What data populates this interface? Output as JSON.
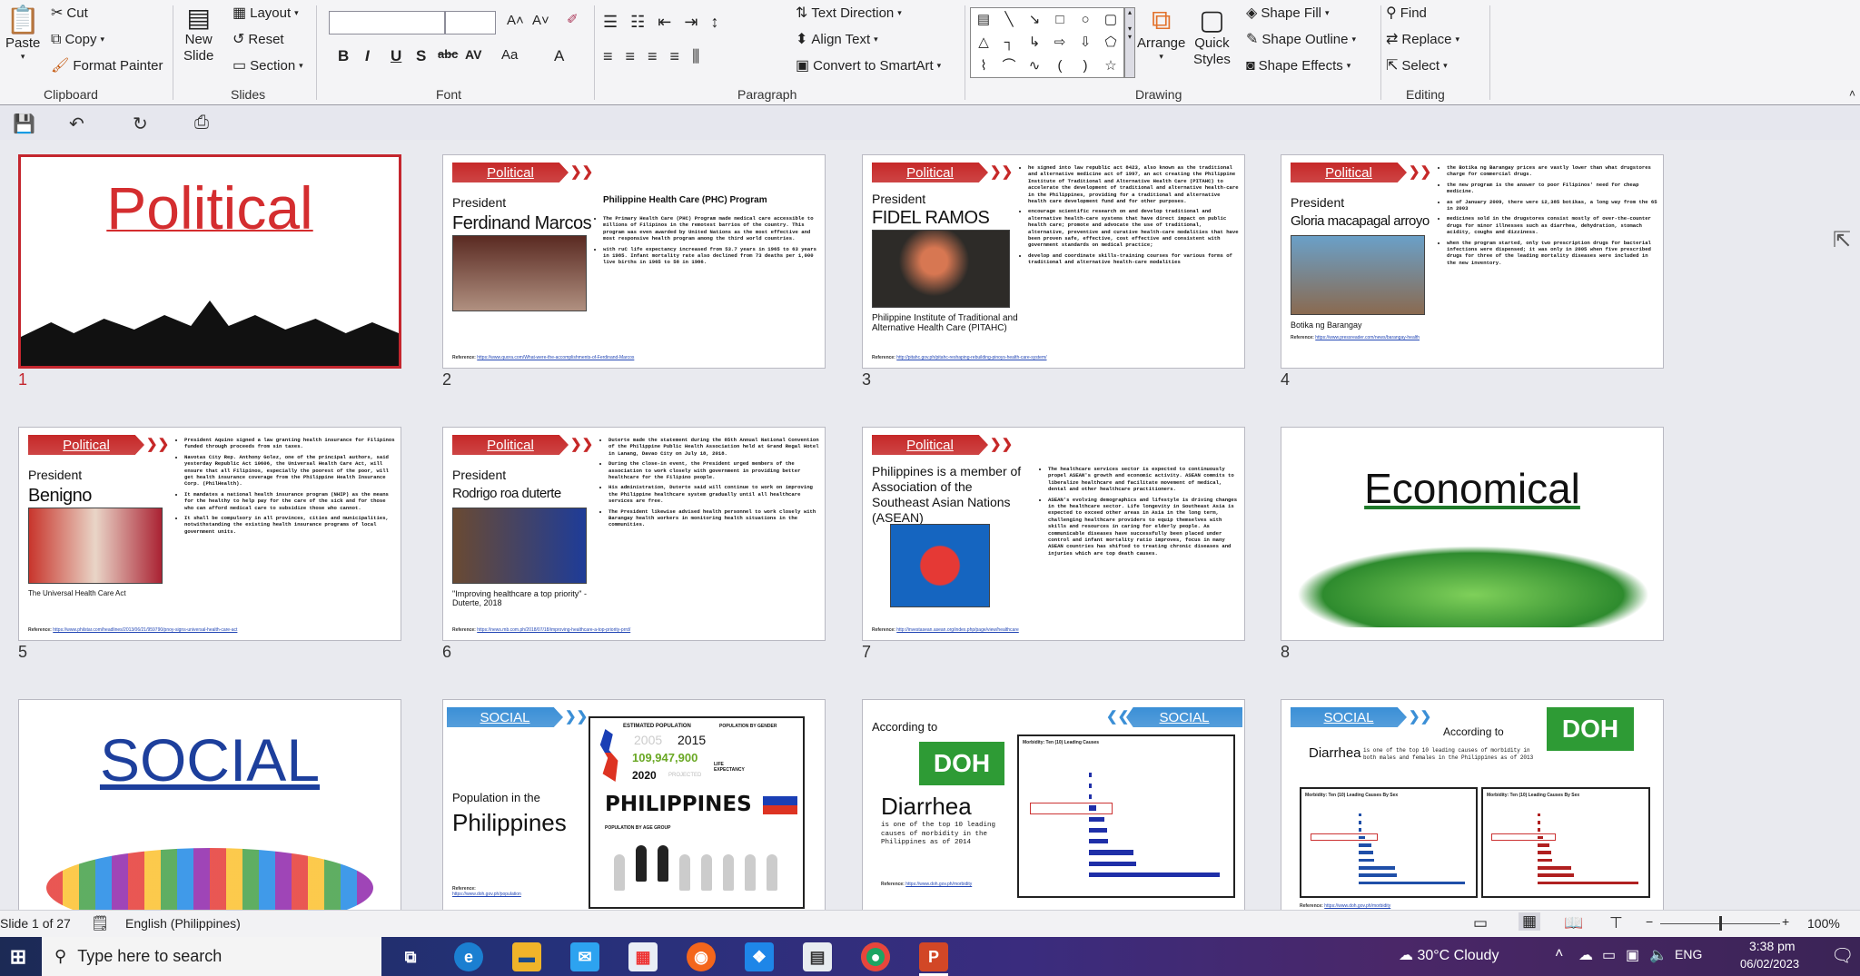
{
  "ribbon": {
    "clipboard": {
      "label": "Clipboard",
      "paste": "Paste",
      "cut": "Cut",
      "copy": "Copy",
      "format_painter": "Format Painter"
    },
    "slides": {
      "label": "Slides",
      "new_slide_1": "New",
      "new_slide_2": "Slide",
      "layout": "Layout",
      "reset": "Reset",
      "section": "Section"
    },
    "font": {
      "label": "Font",
      "font_name": "",
      "font_size": "",
      "grow": "A˄",
      "shrink": "A˅",
      "bold": "B",
      "italic": "I",
      "underline": "U",
      "shadow": "S",
      "strike": "abc",
      "spacing": "AV",
      "case": "Aa",
      "color": "A"
    },
    "paragraph": {
      "label": "Paragraph",
      "text_direction": "Text Direction",
      "align_text": "Align Text",
      "smartart": "Convert to SmartArt"
    },
    "drawing": {
      "label": "Drawing",
      "shapes": [
        "▤",
        "╲",
        "↘",
        "□",
        "○",
        "▢",
        "△",
        "┐",
        "↳",
        "⇨",
        "⇩",
        "⬠",
        "⌇",
        "⌒",
        "∿",
        "(",
        ")",
        "☆"
      ],
      "arrange": "Arrange",
      "quick_styles_1": "Quick",
      "quick_styles_2": "Styles",
      "shape_fill": "Shape Fill",
      "shape_outline": "Shape Outline",
      "shape_effects": "Shape Effects"
    },
    "editing": {
      "label": "Editing",
      "find": "Find",
      "replace": "Replace",
      "select": "Select"
    }
  },
  "qat": {
    "save": "💾",
    "undo": "↶",
    "redo": "↻",
    "present": "⎙"
  },
  "slides": [
    {
      "num": "1",
      "kind": "title",
      "title": "Political",
      "color": "#d42d2f"
    },
    {
      "num": "2",
      "kind": "political",
      "banner": "Political",
      "pre": "President",
      "name": "Ferdinand Marcos",
      "subhead": "Philippine Health Care (PHC) Program",
      "bullets": [
        "The Primary Health Care (PHC) Program made medical care accessible to millions of Filipinos in the remotest barrios of the country. This program was even awarded by United Nations as the most effective and most responsive health program among the third world countries.",
        "with ruC life expectancy increased from 53.7 years in 1965 to 63 years in 1985. Infant mortality rate also declined from 73 deaths per 1,000 live births in 1965 to 58 in 1986."
      ],
      "ref_label": "Reference:",
      "ref": "https://www.quora.com/What-were-the-accomplishments-of-Ferdinand-Marcos"
    },
    {
      "num": "3",
      "kind": "political",
      "banner": "Political",
      "pre": "President",
      "name": "FIDEL RAMOS",
      "caption": "Philippine Institute of Traditional and Alternative Health Care (PITAHC)",
      "bullets": [
        "he signed into law republic act 8423, also known as the traditional and alternative medicine act of 1997, an act creating the Philippine Institute of Traditional and Alternative Health Care (PITAHC) to accelerate the development of traditional and alternative health-care in the Philippines, providing for a traditional and alternative health care development fund and for other purposes.",
        "encourage scientific research on and develop traditional and alternative health-care systems that have direct impact on public health care; promote and advocate the use of traditional, alternative, preventive and curative health-care modalities that have been proven safe, effective, cost effective and consistent with government standards on medical practice;",
        "develop and coordinate skills-training courses for various forms of traditional and alternative health-care modalities"
      ],
      "ref_label": "Reference:",
      "ref": "http://pitahc.gov.ph/pitahc-reshaping-rebuilding-pinoys-health-care-system/"
    },
    {
      "num": "4",
      "kind": "political",
      "banner": "Political",
      "pre": "President",
      "name": "Gloria macapagal arroyo",
      "caption": "Botika ng Barangay",
      "bullets": [
        "the Botika ng Barangay prices are vastly lower than what drugstores charge for commercial drugs.",
        "the new program is the answer to poor Filipinos' need for cheap medicine.",
        "as of January 2009, there were 12,385 botikas, a long way from the 65 in 2003",
        "medicines sold in the drugstores consist mostly of over-the-counter drugs for minor illnesses such as diarrhea, dehydration, stomach acidity, coughs and dizziness.",
        "when the program started, only two prescription drugs for bacterial infections were dispensed; it was only in 2005 when five prescribed drugs for three of the leading mortality diseases were included in the new inventory."
      ],
      "ref_label": "Reference:",
      "ref": "https://www.pressreader.com/news/barangay-health"
    },
    {
      "num": "5",
      "kind": "political",
      "banner": "Political",
      "pre": "President",
      "name": "Benigno",
      "caption": "The Universal Health Care Act",
      "bullets": [
        "President Aquino signed a law granting health insurance for Filipinos funded through proceeds from sin taxes.",
        "Navotas City Rep. Anthony Golez, one of the principal authors, said yesterday Republic Act 10606, the Universal Health Care Act, will ensure that all Filipinos, especially the poorest of the poor, will get health insurance coverage from the Philippine Health Insurance Corp. (PhilHealth).",
        "It mandates a national health insurance program (NHIP) as the means for the healthy to help pay for the care of the sick and for those who can afford medical care to subsidize those who cannot.",
        "It shall be compulsory in all provinces, cities and municipalities, notwithstanding the existing health insurance programs of local government units."
      ],
      "ref_label": "Reference:",
      "ref": "https://www.philstar.com/headlines/2013/06/21/959790/pnoy-signs-universal-health-care-act"
    },
    {
      "num": "6",
      "kind": "political",
      "banner": "Political",
      "pre": "President",
      "name": "Rodrigo roa duterte",
      "caption": "\"Improving healthcare a top priority\" -Duterte, 2018",
      "bullets": [
        "Duterte made the statement during the 85th Annual National Convention of the Philippine Public Health Association held at Grand Regal Hotel in Lanang, Davao City on July 18, 2018.",
        "During the close-in event, the President urged members of the association to work closely with government in providing better healthcare for the Filipino people.",
        "His administration, Duterte said will continue to work on improving the Philippine healthcare system gradually until all healthcare services are free.",
        "The President likewise advised health personnel to work closely with Barangay health workers in monitoring health situations in the communities."
      ],
      "ref_label": "Reference:",
      "ref": "https://news.mb.com.ph/2018/07/18/improving-healthcare-a-top-priority-prrd/"
    },
    {
      "num": "7",
      "kind": "political",
      "banner": "Political",
      "pre": "",
      "name": "Philippines is a member of Association of the Southeast Asian Nations (ASEAN)",
      "bullets": [
        "The healthcare services sector is expected to continuously propel ASEAN's growth and economic activity. ASEAN commits to liberalize healthcare and facilitate movement of medical, dental and other healthcare practitioners.",
        "ASEAN's evolving demographics and lifestyle is driving changes in the healthcare sector. Life longevity in Southeast Asia is expected to exceed other areas in Asia in the long term, challenging healthcare providers to equip themselves with skills and resources in caring for elderly people. As communicable diseases have successfully been placed under control and infant mortality ratio improves, focus in many ASEAN countries has shifted to treating chronic diseases and injuries which are top death causes."
      ],
      "ref_label": "Reference:",
      "ref": "http://investasean.asean.org/index.php/page/view/healthcare"
    },
    {
      "num": "8",
      "kind": "title",
      "title": "Economical",
      "color": "#1f7a2a"
    },
    {
      "num": "9",
      "kind": "title",
      "title": "SOCIAL",
      "color": "#1d3f9c"
    },
    {
      "num": "10",
      "kind": "population",
      "banner": "SOCIAL",
      "pre": "Population in the",
      "name": "Philippines",
      "info_head": "ESTIMATED POPULATION",
      "info_gender": "POPULATION BY GENDER",
      "year1": "2005",
      "year2": "2015",
      "population": "109,947,900",
      "year3": "2020",
      "projected": "PROJECTED",
      "life": "LIFE EXPECTANCY",
      "country": "PHILIPPINES",
      "age_group": "POPULATION BY AGE GROUP",
      "ref_label": "Reference:",
      "ref": "https://www.doh.gov.ph/population"
    },
    {
      "num": "11",
      "kind": "doh1",
      "banner": "SOCIAL",
      "pre": "According to",
      "logo": "DOH",
      "name": "Diarrhea",
      "desc": "is one of the top 10 leading causes of morbidity in the Philippines as of 2014",
      "chart_title": "Morbidity: Ten (10) Leading Causes",
      "ref_label": "Reference:",
      "ref": "https://www.doh.gov.ph/morbidity"
    },
    {
      "num": "12",
      "kind": "doh2",
      "banner": "SOCIAL",
      "pre": "According to",
      "logo": "DOH",
      "name": "Diarrhea",
      "desc": "is one of the top 10 leading causes of morbidity in both males and females in the Philippines as of 2013",
      "chart_title": "Morbidity: Ten (10) Leading Causes By Sex",
      "ref_label": "Reference:",
      "ref": "https://www.doh.gov.ph/morbidity"
    }
  ],
  "status": {
    "slide_count": "Slide 1 of 27",
    "language": "English (Philippines)",
    "zoom": "100%",
    "zoom_level": 100
  },
  "taskbar": {
    "search_placeholder": "Type here to search",
    "weather": "30°C  Cloudy",
    "lang": "ENG",
    "time": "3:38 pm",
    "date": "06/02/2023"
  },
  "colors": {
    "political": "#c62828",
    "social": "#3b8fd6",
    "selected": "#c4262e"
  }
}
